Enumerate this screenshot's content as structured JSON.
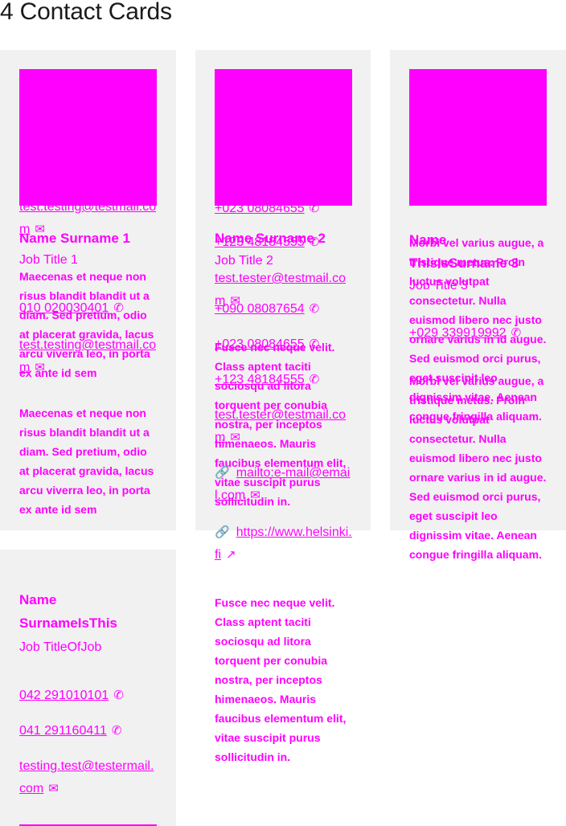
{
  "heading": "4 Contact Cards",
  "cards": [
    {
      "name": "Name Surname 1",
      "job": "Job Title 1",
      "phone1": "010 020030401",
      "email": "test.testing@testmail.com",
      "email_dup": "test.testing@testmail.com",
      "body1": "Maecenas et neque non risus blandit blandit ut a diam. Sed pretium, odio at placerat gravida, lacus arcu viverra leo, in porta ex ante id sem",
      "body2": "Maecenas et neque non risus blandit blandit ut a diam. Sed pretium, odio at placerat gravida, lacus arcu viverra leo, in porta ex ante id sem"
    },
    {
      "name": "Name Surname 2",
      "job": "Job Title 2",
      "phone_a": "+023 08084655",
      "phone_b": "+123 48184555",
      "email": "test.tester@testmail.com",
      "phone_c": "+090 08087654",
      "phone_d": "+023 08084655",
      "phone_e": "+123 48184555",
      "email2": "test.tester@testmail.com",
      "mailto": "mailto:e-mail@email.com",
      "url": "https://www.helsinki.fi",
      "body1": "Fusce nec neque velit. Class aptent taciti sociosqu ad litora torquent per conubia nostra, per inceptos himenaeos. Mauris faucibus elementum elit, vitae suscipit purus sollicitudin in.",
      "body2": "Fusce nec neque velit. Class aptent taciti sociosqu ad litora torquent per conubia nostra, per inceptos himenaeos. Mauris faucibus elementum elit, vitae suscipit purus sollicitudin in."
    },
    {
      "name": "Name ThisIsSurname 3",
      "job": "Job Title 3",
      "phone": "+029 339919992",
      "body1": "Morbi vel varius augue, a tristique metus. Proin luctus volutpat consectetur. Nulla euismod libero nec justo ornare varius in id augue. Sed euismod orci purus, eget suscipit leo dignissim vitae. Aenean congue fringilla aliquam.",
      "body2": "Morbi vel varius augue, a tristique metus. Proin luctus volutpat consectetur. Nulla euismod libero nec justo ornare varius in id augue. Sed euismod orci purus, eget suscipit leo dignissim vitae. Aenean congue fringilla aliquam."
    },
    {
      "name": "Name SurnameIsThis",
      "job": "Job TitleOfJob",
      "phone1": "042 291010101",
      "phone2": "041 291160411",
      "email": "testing.test@testermail.com"
    }
  ],
  "icons": {
    "phone": "phone-icon",
    "mail": "mail-icon",
    "link": "link-icon",
    "external": "external-link-icon"
  }
}
